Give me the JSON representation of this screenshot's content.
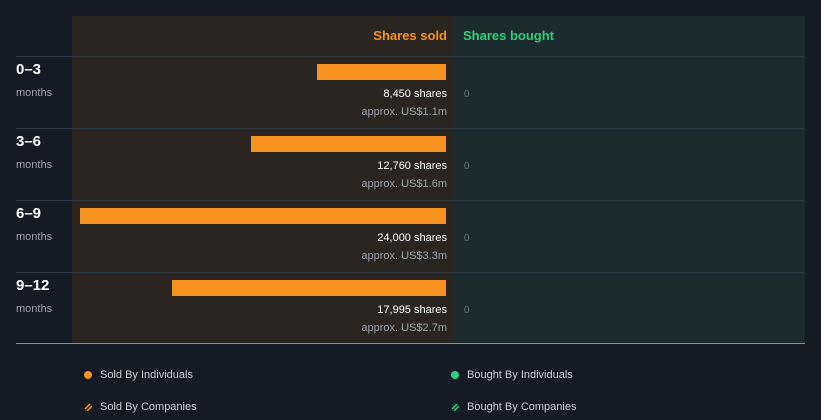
{
  "chart_data": {
    "type": "bar",
    "orientation": "horizontal",
    "columns": {
      "sold": "Shares sold",
      "bought": "Shares bought"
    },
    "categories": [
      {
        "label": "0–3",
        "sublabel": "months"
      },
      {
        "label": "3–6",
        "sublabel": "months"
      },
      {
        "label": "6–9",
        "sublabel": "months"
      },
      {
        "label": "9–12",
        "sublabel": "months"
      }
    ],
    "series": [
      {
        "name": "Sold By Individuals",
        "values": [
          8450,
          12760,
          24000,
          17995
        ],
        "value_labels": [
          "8,450 shares",
          "12,760 shares",
          "24,000 shares",
          "17,995 shares"
        ],
        "approx_labels": [
          "approx. US$1.1m",
          "approx. US$1.6m",
          "approx. US$3.3m",
          "approx. US$2.7m"
        ]
      },
      {
        "name": "Bought By Individuals",
        "values": [
          0,
          0,
          0,
          0
        ],
        "value_labels": [
          "0",
          "0",
          "0",
          "0"
        ]
      }
    ],
    "legend": [
      {
        "label": "Sold By Individuals",
        "color": "#f7931e",
        "icon": "dot"
      },
      {
        "label": "Bought By Individuals",
        "color": "#2ecf7d",
        "icon": "dot"
      },
      {
        "label": "Sold By Companies",
        "color": "#f7931e",
        "icon": "hatched-dot"
      },
      {
        "label": "Bought By Companies",
        "color": "#2ecf7d",
        "icon": "hatched-dot"
      }
    ],
    "legend_position": "bottom",
    "colors": {
      "sold": "#f7931e",
      "bought": "#2ecf7d"
    }
  }
}
